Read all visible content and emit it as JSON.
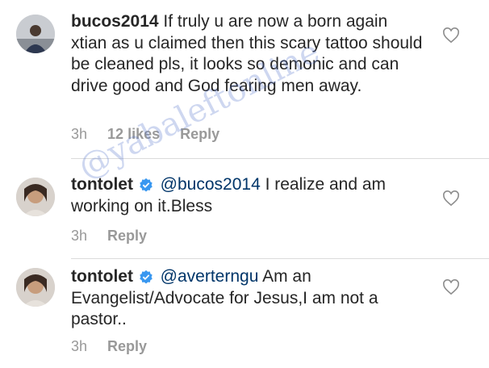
{
  "comments": [
    {
      "username": "bucos2014",
      "verified": false,
      "mention": "",
      "body": "If truly u are now a born again xtian as u claimed then this scary tattoo should be cleaned pls, it looks so demonic and can drive good and God fearing men away.",
      "time": "3h",
      "likes": "12 likes",
      "reply": "Reply"
    },
    {
      "username": "tontolet",
      "verified": true,
      "mention": "@bucos2014",
      "body": "I realize and am working on it.Bless",
      "time": "3h",
      "likes": "",
      "reply": "Reply"
    },
    {
      "username": "tontolet",
      "verified": true,
      "mention": "@averterngu",
      "body": "Am an Evangelist/Advocate for Jesus,I am not a pastor..",
      "time": "3h",
      "likes": "",
      "reply": "Reply"
    }
  ],
  "watermark": "@yabaleftonline",
  "icons": {
    "like": "heart-outline-icon",
    "verified": "verified-badge-icon"
  },
  "colors": {
    "verified": "#3897f0",
    "meta": "#999999",
    "text": "#262626"
  }
}
